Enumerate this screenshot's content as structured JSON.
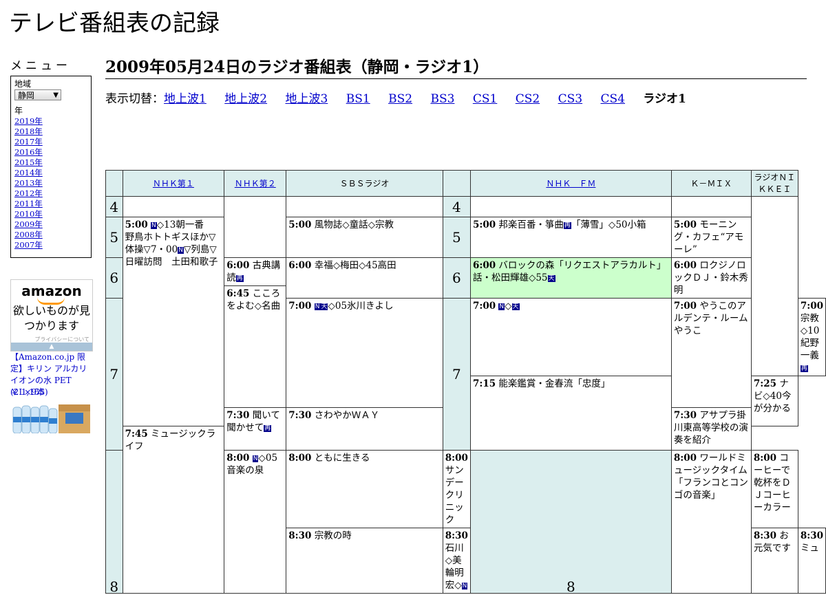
{
  "site_title": "テレビ番組表の記録",
  "menu": {
    "title": "メニュー",
    "region_label": "地域",
    "region_value": "静岡",
    "year_label": "年",
    "years": [
      "2019年",
      "2018年",
      "2017年",
      "2016年",
      "2015年",
      "2014年",
      "2013年",
      "2012年",
      "2011年",
      "2010年",
      "2009年",
      "2008年",
      "2007年"
    ]
  },
  "ad": {
    "logo": "amazon",
    "tagline": "欲しいものが見つかります",
    "privacy": "プライバシーについて",
    "product": "【Amazon.co.jp 限定】キリン アルカリイオンの水 PET (2L×9本)",
    "price": "￥ 1,155"
  },
  "page_heading": "2009年05月24日のラジオ番組表（静岡・ラジオ1）",
  "switcher": {
    "label": "表示切替：",
    "links": [
      "地上波1",
      "地上波2",
      "地上波3",
      "BS1",
      "BS2",
      "BS3",
      "CS1",
      "CS2",
      "CS3",
      "CS4"
    ],
    "current": "ラジオ1"
  },
  "channels": [
    "ＮＨＫ第１",
    "ＮＨＫ第２",
    "ＳＢＳラジオ",
    "ＮＨＫ　ＦＭ",
    "Ｋ－ＭＩＸ",
    "ラジオＮＩＫＫＥＩ"
  ],
  "hours": [
    "4",
    "5",
    "6",
    "7",
    "8"
  ],
  "badges": {
    "news": "N",
    "weather": "天",
    "rebroadcast": "再"
  },
  "programs": {
    "nhk1_500": {
      "time": "5:00",
      "pre": "",
      "post": "◇13朝一番　野鳥ホトトギスほか▽体操▽7・00",
      "post2": "▽列島▽日曜訪問　土田和歌子"
    },
    "nhk1_800": {
      "time": "8:00",
      "post": "◇05音楽の泉"
    },
    "nhk2_600": {
      "time": "6:00",
      "text": "古典講読"
    },
    "nhk2_645": {
      "time": "6:45",
      "text": "こころをよむ◇名曲"
    },
    "nhk2_730": {
      "time": "7:30",
      "text": "聞いて聞かせて"
    },
    "nhk2_800": {
      "time": "8:00",
      "text": "ともに生きる"
    },
    "nhk2_830": {
      "time": "8:30",
      "text": "宗教の時"
    },
    "sbs_500": {
      "time": "5:00",
      "text": "風物誌◇童話◇宗教"
    },
    "sbs_600": {
      "time": "6:00",
      "text": "幸福◇梅田◇45高田"
    },
    "sbs_700": {
      "time": "7:00",
      "text": "◇05氷川きよし"
    },
    "sbs_730": {
      "time": "7:30",
      "text": "さわやかＷＡＹ"
    },
    "sbs_800": {
      "time": "8:00",
      "text": "サンデークリニック"
    },
    "sbs_830": {
      "time": "8:30",
      "text": "石川◇美輪明宏◇"
    },
    "fm_500": {
      "time": "5:00",
      "text": "邦楽百番・箏曲",
      "text2": "「薄雪」◇50小箱"
    },
    "fm_600": {
      "time": "6:00",
      "text": "バロックの森「リクエストアラカルト」話・松田輝雄◇55"
    },
    "fm_700": {
      "time": "7:00",
      "text": "◇"
    },
    "fm_715": {
      "time": "7:15",
      "text": "能楽鑑賞・金春流「忠度」"
    },
    "fm_800": {
      "time": "8:00",
      "text": "ワールドミュージックタイム「フランコとコンゴの音楽」"
    },
    "kmix_500": {
      "time": "5:00",
      "text": "モーニング・カフェ“アモーレ”"
    },
    "kmix_600": {
      "time": "6:00",
      "text": "ロクジノロックＤＪ・鈴木秀明"
    },
    "kmix_700": {
      "time": "7:00",
      "text": "やうこのアルデンテ・ルームやうこ"
    },
    "kmix_730": {
      "time": "7:30",
      "text": "アサプラ掛川東高等学校の演奏を紹介"
    },
    "kmix_800": {
      "time": "8:00",
      "text": "コーヒーで乾杯をＤＪコーヒーカラー"
    },
    "kmix_830": {
      "time": "8:30",
      "text": "お元気です"
    },
    "nikkei_700": {
      "time": "7:00",
      "text": "宗教◇10紀野一義"
    },
    "nikkei_725": {
      "time": "7:25",
      "text": "ナビ◇40今が分かる"
    },
    "nikkei_745": {
      "time": "7:45",
      "text": "ミュージックライフ"
    },
    "nikkei_830": {
      "time": "8:30",
      "text": "ミュ"
    }
  }
}
